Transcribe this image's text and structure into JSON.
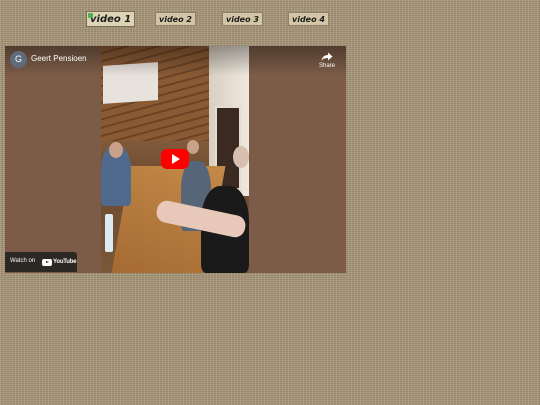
{
  "tabs": [
    {
      "label": "video 1",
      "active": true
    },
    {
      "label": "video 2",
      "active": false
    },
    {
      "label": "video 3",
      "active": false
    },
    {
      "label": "video 4",
      "active": false
    }
  ],
  "player": {
    "avatar_letter": "G",
    "channel_name": "Geert Pensioen",
    "share_label": "Share",
    "watch_label": "Watch on",
    "youtube_label": "YouTube",
    "icons": [
      "share-icon",
      "play-icon",
      "youtube-logo-icon"
    ]
  },
  "colors": {
    "play_button": "#ff0000",
    "active_tab_marker": "#4caf50"
  }
}
